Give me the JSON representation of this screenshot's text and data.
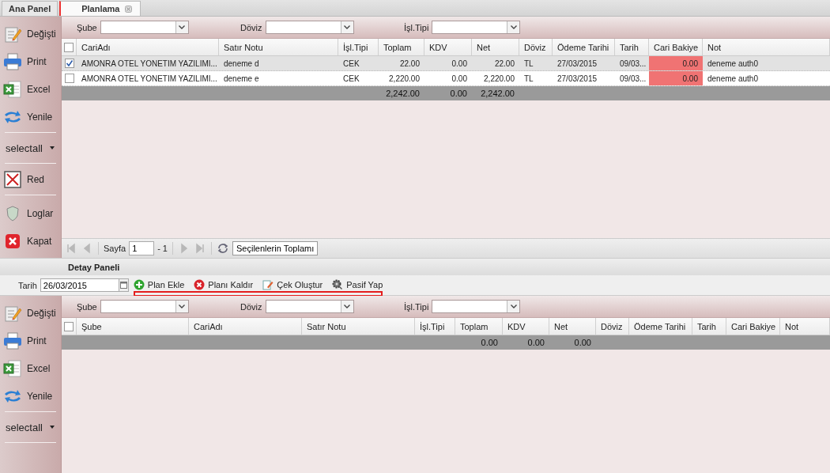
{
  "tabs": [
    {
      "label": "Ana Panel",
      "selected": false,
      "closable": false
    },
    {
      "label": "Planlama",
      "selected": true,
      "closable": true
    }
  ],
  "top_panel": {
    "sidebar": [
      {
        "kind": "edit",
        "label": "Değişti"
      },
      {
        "kind": "print",
        "label": "Print"
      },
      {
        "kind": "excel",
        "label": "Excel"
      },
      {
        "kind": "refresh",
        "label": "Yenile"
      },
      {
        "kind": "separator"
      },
      {
        "kind": "dropdown",
        "label": "selectall"
      },
      {
        "kind": "separator"
      },
      {
        "kind": "reject",
        "label": "Red"
      },
      {
        "kind": "separator"
      },
      {
        "kind": "spacer"
      },
      {
        "kind": "log",
        "label": "Loglar"
      },
      {
        "kind": "close",
        "label": "Kapat"
      }
    ],
    "filters": [
      {
        "label": "Şube"
      },
      {
        "label": "Döviz"
      },
      {
        "label": "İşl.Tipi"
      }
    ],
    "grid": {
      "select_all_checked": false,
      "columns": [
        {
          "label": "CariAdı",
          "kind": "text"
        },
        {
          "label": "Satır Notu",
          "kind": "text"
        },
        {
          "label": "İşl.Tipi",
          "kind": "text"
        },
        {
          "label": "Toplam",
          "kind": "number",
          "total": "2,242.00"
        },
        {
          "label": "KDV",
          "kind": "number",
          "total": "0.00"
        },
        {
          "label": "Net",
          "kind": "number",
          "total": "2,242.00"
        },
        {
          "label": "Döviz",
          "kind": "text"
        },
        {
          "label": "Ödeme Tarihi",
          "kind": "text"
        },
        {
          "label": "Tarih",
          "kind": "text"
        },
        {
          "label": "Cari Bakiye",
          "kind": "balance"
        },
        {
          "label": "Not",
          "kind": "text"
        }
      ],
      "rows": [
        {
          "selected": true,
          "balance_alert": true,
          "cells": [
            "AMONRA OTEL YONETIM YAZILIMI...",
            "deneme d",
            "CEK",
            "22.00",
            "0.00",
            "22.00",
            "TL",
            "27/03/2015",
            "09/03...",
            "0.00",
            "deneme auth0"
          ]
        },
        {
          "selected": false,
          "balance_alert": true,
          "cells": [
            "AMONRA OTEL YONETIM YAZILIMI...",
            "deneme e",
            "CEK",
            "2,220.00",
            "0.00",
            "2,220.00",
            "TL",
            "27/03/2015",
            "09/03...",
            "0.00",
            "deneme auth0"
          ]
        }
      ]
    },
    "pager": {
      "nav_disabled": true,
      "page_label": "Sayfa",
      "page_value": "1",
      "page_count": "- 1",
      "summary_button": "Seçilenlerin Toplamı"
    }
  },
  "detail_panel": {
    "title": "Detay Paneli",
    "date_label": "Tarih",
    "date_value": "26/03/2015",
    "actions_highlighted": true,
    "actions": [
      {
        "kind": "add",
        "label": "Plan Ekle"
      },
      {
        "kind": "remove",
        "label": "Planı Kaldır"
      },
      {
        "kind": "create",
        "label": "Çek Oluştur"
      },
      {
        "kind": "passive",
        "label": "Pasif Yap"
      }
    ],
    "sidebar": [
      {
        "kind": "edit",
        "label": "Değişti"
      },
      {
        "kind": "print",
        "label": "Print"
      },
      {
        "kind": "excel",
        "label": "Excel"
      },
      {
        "kind": "refresh",
        "label": "Yenile"
      },
      {
        "kind": "separator"
      },
      {
        "kind": "dropdown",
        "label": "selectall"
      },
      {
        "kind": "separator"
      }
    ],
    "filters": [
      {
        "label": "Şube"
      },
      {
        "label": "Döviz"
      },
      {
        "label": "İşl.Tipi"
      }
    ],
    "grid": {
      "select_all_checked": false,
      "columns": [
        {
          "label": "Şube"
        },
        {
          "label": "CariAdı"
        },
        {
          "label": "Satır Notu"
        },
        {
          "label": "İşl.Tipi"
        },
        {
          "label": "Toplam",
          "total": "0.00"
        },
        {
          "label": "KDV",
          "total": "0.00"
        },
        {
          "label": "Net",
          "total": "0.00"
        },
        {
          "label": "Döviz"
        },
        {
          "label": "Ödeme Tarihi"
        },
        {
          "label": "Tarih"
        },
        {
          "label": "Cari Bakiye"
        },
        {
          "label": "Not"
        }
      ]
    }
  }
}
